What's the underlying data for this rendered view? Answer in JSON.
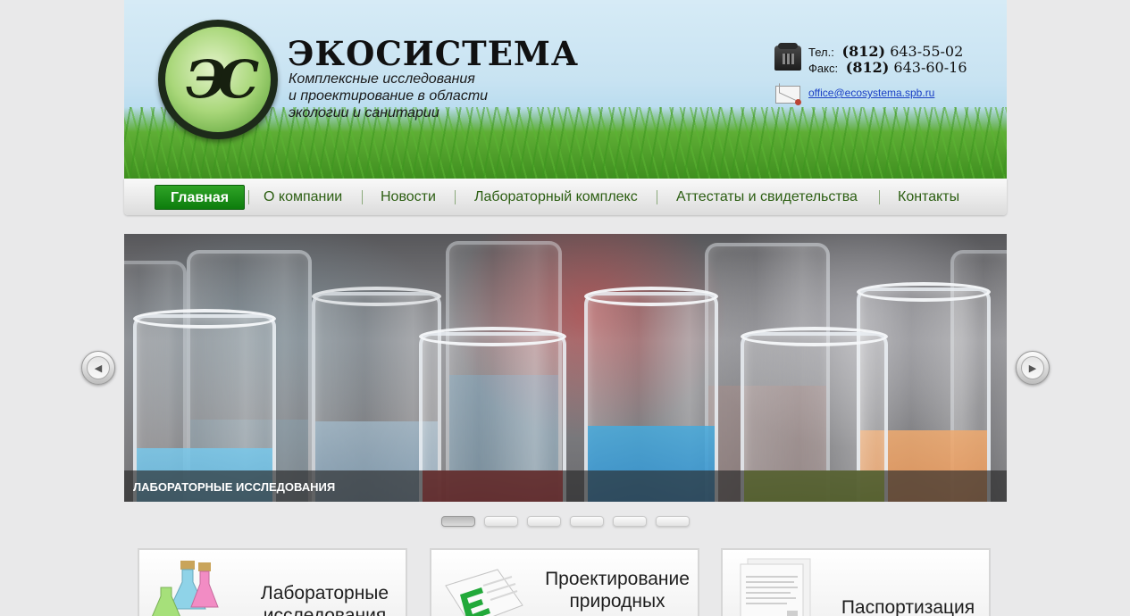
{
  "header": {
    "logo_letters": "ЭС",
    "brand": "ЭКОСИСТЕМА",
    "tagline": [
      "Комплексные исследования",
      "и проектирование в области",
      "экологии и санитарии"
    ],
    "phone_label": "Тел.:",
    "phone_code": "(812)",
    "phone_number": "643-55-02",
    "fax_label": "Факс:",
    "fax_code": "(812)",
    "fax_number": "643-60-16",
    "email": "office@ecosystema.spb.ru"
  },
  "nav": {
    "items": [
      {
        "label": "Главная",
        "active": true
      },
      {
        "label": "О компании"
      },
      {
        "label": "Новости"
      },
      {
        "label": "Лабораторный комплекс"
      },
      {
        "label": "Аттестаты и свидетельства"
      },
      {
        "label": "Контакты"
      }
    ]
  },
  "slider": {
    "caption": "ЛАБОРАТОРНЫЕ ИССЛЕДОВАНИЯ",
    "prev_icon": "chevron-left-icon",
    "next_icon": "chevron-right-icon",
    "slide_count": 6,
    "active_index": 0
  },
  "cards": [
    {
      "title_line1": "Лабораторные",
      "title_line2": "исследования",
      "icon": "flasks-icon"
    },
    {
      "title_line1": "Проектирование",
      "title_line2": "природных",
      "icon": "document-icon"
    },
    {
      "title_line1": "Паспортизация",
      "title_line2": "",
      "icon": "papers-icon"
    }
  ],
  "colors": {
    "nav_active": "#1a8f18",
    "nav_text": "#2c5e12",
    "link": "#1a3fc5"
  }
}
